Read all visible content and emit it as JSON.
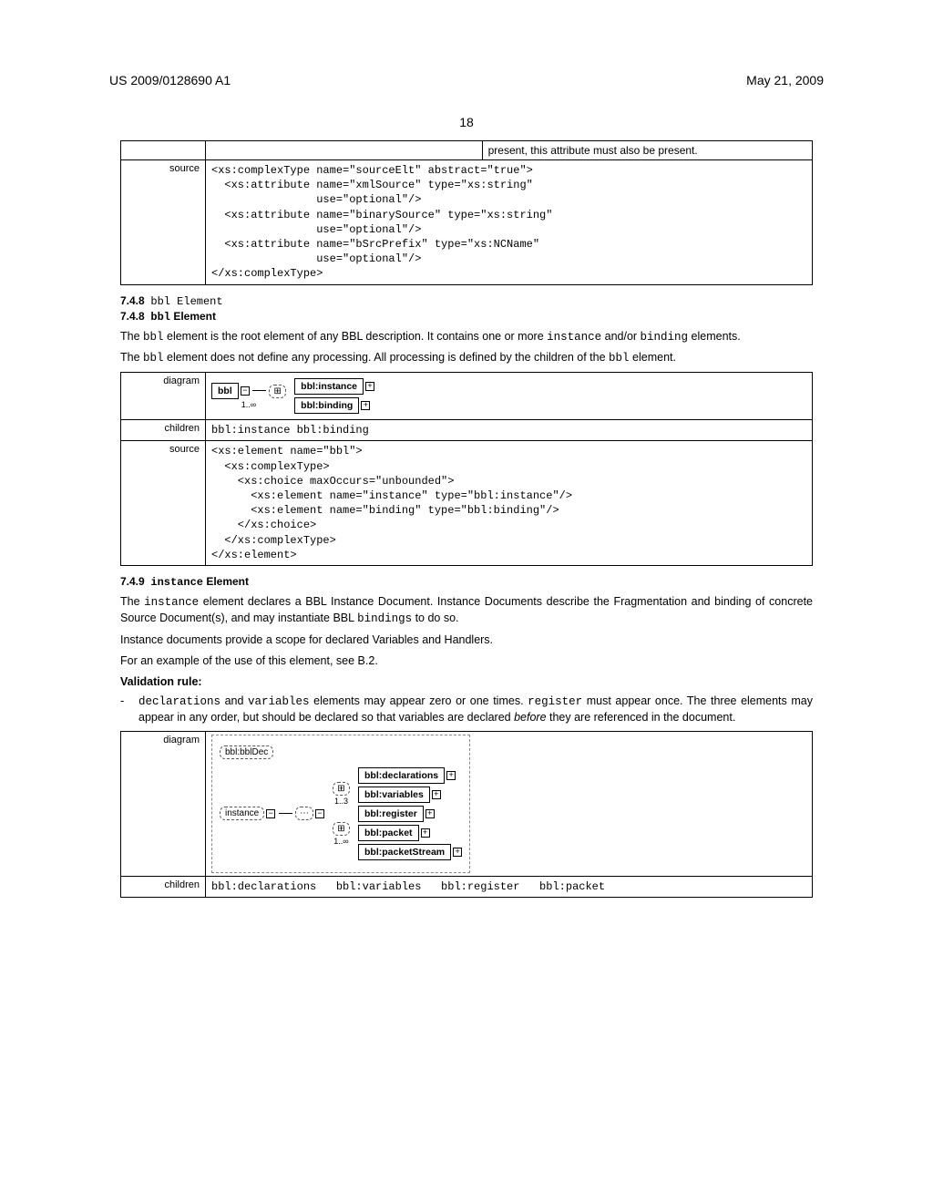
{
  "header": {
    "left": "US 2009/0128690 A1",
    "right": "May 21, 2009"
  },
  "page_number": "18",
  "table1": {
    "topnote": "present, this attribute must also be present.",
    "label": "source",
    "source": "<xs:complexType name=\"sourceElt\" abstract=\"true\">\n  <xs:attribute name=\"xmlSource\" type=\"xs:string\"\n                use=\"optional\"/>\n  <xs:attribute name=\"binarySource\" type=\"xs:string\"\n                use=\"optional\"/>\n  <xs:attribute name=\"bSrcPrefix\" type=\"xs:NCName\"\n                use=\"optional\"/>\n</xs:complexType>"
  },
  "sec748": {
    "num": "7.4.8",
    "title": "bbl Element",
    "p1a": "The ",
    "p1b": "bbl",
    "p1c": " element is the root element of any BBL description. It contains one or more ",
    "p1d": "instance",
    "p1e": " and/or ",
    "p1f": "binding",
    "p1g": " elements.",
    "p2a": "The ",
    "p2b": "bbl",
    "p2c": " element does not define any processing. All processing is defined by the children of the ",
    "p2d": "bbl",
    "p2e": " element."
  },
  "table2": {
    "diagram_label": "diagram",
    "children_label": "children",
    "source_label": "source",
    "diag": {
      "bbl": "bbl",
      "occ": "1..∞",
      "inst": "bbl:instance",
      "bind": "bbl:binding"
    },
    "children": "bbl:instance bbl:binding",
    "source": "<xs:element name=\"bbl\">\n  <xs:complexType>\n    <xs:choice maxOccurs=\"unbounded\">\n      <xs:element name=\"instance\" type=\"bbl:instance\"/>\n      <xs:element name=\"binding\" type=\"bbl:binding\"/>\n    </xs:choice>\n  </xs:complexType>\n</xs:element>"
  },
  "sec749": {
    "num": "7.4.9",
    "title": "instance Element",
    "p1a": "The ",
    "p1b": "instance",
    "p1c": " element declares a BBL Instance Document. Instance Documents describe the Fragmentation and binding of concrete Source Document(s), and may instantiate BBL ",
    "p1d": "bindings",
    "p1e": " to do so.",
    "p2": "Instance documents provide a scope for declared Variables and Handlers.",
    "p3": "For an example of the use of this element, see B.2.",
    "validation_head": "Validation rule:",
    "bullet_a": "declarations",
    "bullet_b": " and ",
    "bullet_c": "variables",
    "bullet_d": " elements may appear zero or one times. ",
    "bullet_e": "register",
    "bullet_f": " must appear once. The three elements may appear in any order, but should be declared so that variables are declared ",
    "bullet_g": "before",
    "bullet_h": " they are referenced in the document."
  },
  "table3": {
    "diagram_label": "diagram",
    "children_label": "children",
    "diag": {
      "instance": "instance",
      "bblDec": "bbl:bblDec",
      "occ1": "1..3",
      "occ2": "1..∞",
      "decl": "bbl:declarations",
      "vars": "bbl:variables",
      "reg": "bbl:register",
      "packet": "bbl:packet",
      "pstream": "bbl:packetStream"
    },
    "children": "bbl:declarations   bbl:variables   bbl:register   bbl:packet"
  }
}
